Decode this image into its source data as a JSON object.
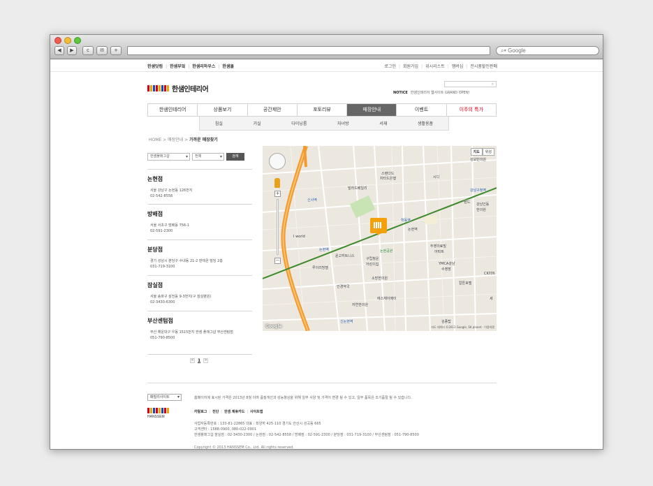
{
  "browser": {
    "search_placeholder": "Google",
    "nav_back": "◀",
    "nav_fwd": "▶",
    "reload": "c",
    "bookmarks": "✉",
    "add": "+"
  },
  "family_sites": [
    "한샘닷컴",
    "한샘부엌",
    "한샘리하우스",
    "한샘몰"
  ],
  "util_menu": [
    "로그인",
    "회원가입",
    "위시리스트",
    "멤버십",
    "전시품할인판매"
  ],
  "brand": {
    "name": "한샘인테리어",
    "bar_colors": [
      "#d6001c",
      "#f2a10d",
      "#1a4ea0",
      "#d6001c",
      "#f2a10d",
      "#1a4ea0",
      "#d6001c",
      "#f2a10d"
    ]
  },
  "search": {
    "icon": "search-icon"
  },
  "notice": {
    "label": "NOTICE",
    "text": "한샘인테리어 웹사이트 GRAND OPEN!"
  },
  "gnb": [
    "한샘인테리어",
    "상품보기",
    "공간제안",
    "포토리뷰",
    "매장안내",
    "이벤트",
    "이주의 특가"
  ],
  "gnb_active": 4,
  "sub_menu": [
    "침실",
    "거실",
    "다이닝룸",
    "자녀방",
    "서재",
    "생활용품"
  ],
  "breadcrumb": {
    "home": "HOME",
    "sep": ">",
    "level1": "매장안내",
    "current": "가까운 매장찾기"
  },
  "filter": {
    "select1": "한샘플래그샵",
    "select2": "전체",
    "button": "검색"
  },
  "stores": [
    {
      "name": "논현점",
      "address": "서울 강남구 논현동 126번지",
      "tel": "02-542-8558"
    },
    {
      "name": "방배점",
      "address": "서울 서초구 방배동 756-1",
      "tel": "02-591-2300"
    },
    {
      "name": "분당점",
      "address": "경기 성남시 분당구 수내동 21-2 판테온 빌딩 2층",
      "tel": "031-719-3100"
    },
    {
      "name": "잠실점",
      "address": "서울 송파구 삼전동 9-3번지(구 잠실병원)",
      "tel": "02-3430-6300"
    },
    {
      "name": "부산센텀점",
      "address": "부산 해운대구 우동 1515번지 한샘 플래그샵 부산센텀점",
      "tel": "051-790-8500"
    }
  ],
  "pager": {
    "prev": "<",
    "current": "1",
    "next": ">"
  },
  "map": {
    "type_map": "지도",
    "type_sat": "위성",
    "labels": [
      {
        "t": "성보빈의원",
        "c": ""
      },
      {
        "t": "스탠다드",
        "c": ""
      },
      {
        "t": "차타드은행",
        "c": ""
      },
      {
        "t": "시디",
        "c": ""
      },
      {
        "t": "빌라드베일리",
        "c": ""
      },
      {
        "t": "강남구청역",
        "c": "b"
      },
      {
        "t": "신사역",
        "c": "b"
      },
      {
        "t": "렌드",
        "c": ""
      },
      {
        "t": "강남인동",
        "c": ""
      },
      {
        "t": "한의원",
        "c": ""
      },
      {
        "t": "학동역",
        "c": "b"
      },
      {
        "t": "I world",
        "c": ""
      },
      {
        "t": "논현역",
        "c": "b"
      },
      {
        "t": "두영의료빌",
        "c": ""
      },
      {
        "t": "아파트",
        "c": ""
      },
      {
        "t": "윤고히트니스",
        "c": ""
      },
      {
        "t": "구립청운",
        "c": ""
      },
      {
        "t": "어린이집",
        "c": ""
      },
      {
        "t": "YMCA강남",
        "c": ""
      },
      {
        "t": "수영장",
        "c": ""
      },
      {
        "t": "루이리빙텔",
        "c": ""
      },
      {
        "t": "소망한의원",
        "c": ""
      },
      {
        "t": "칼튼호텔",
        "c": ""
      },
      {
        "t": "CK마트",
        "c": ""
      },
      {
        "t": "인경약국",
        "c": ""
      },
      {
        "t": "에스체이메이",
        "c": ""
      },
      {
        "t": "자연한의원",
        "c": ""
      },
      {
        "t": "세",
        "c": ""
      },
      {
        "t": "신논현역",
        "c": "b"
      },
      {
        "t": "김종탑",
        "c": ""
      },
      {
        "t": "논현공원",
        "c": "g"
      },
      {
        "t": "논현역",
        "c": ""
      }
    ],
    "logo": "Google",
    "copyright": "지도 데이터 ©2013 Google, SK planet · 이용약관"
  },
  "footer": {
    "family_site": "패밀리사이트",
    "disclaimer": "홈페이지에 표시된 가격은 2013년 8월 이며 품질개선과 성능향상을 위해 일부 사양 및 가격이 변경 될 수 있고, 일부 품목은 조기품절 될 수 있습니다.",
    "brand_sub": "HANSSEM",
    "links": [
      "카탈로그",
      "전단",
      "한샘 제휴카드",
      "사이트맵"
    ],
    "info": [
      "사업자등록번호 : 133-81-22865   대표 : 최양하   425-110 경기도 안산시 성곡동 665",
      "고객센터 : 1588-0900, 080-022-0901",
      "한샘플래그샵 잠실점 : 02-3430-2300 / 논현점 : 02-542-8558 / 방배점 : 02-591-2300 / 분당점 : 031-719-3100 / 부산센텀점 : 051-790-8500"
    ],
    "copyright": "Copyright © 2013 HANSSEM Co., Ltd. All rights reserved."
  }
}
